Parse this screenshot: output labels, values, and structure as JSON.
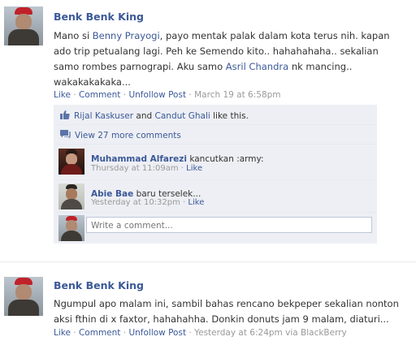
{
  "post1": {
    "author": "Benk Benk King",
    "text_lines": [
      [
        "Mano si ",
        "Benny Prayogi",
        ", payo mentak palak dalam kota terus nih. kapan"
      ],
      [
        "ado trip petualang lagi. Peh ke Semendo kito.. hahahahaha.. sekalian"
      ],
      [
        "samo rombes parnograpi. Aku samo ",
        "Asril Chandra",
        " nk mancing.."
      ],
      [
        "wakakakakaka..."
      ]
    ],
    "actions": {
      "like": "Like",
      "comment": "Comment",
      "unfollow": "Unfollow Post",
      "sep": "·",
      "time": "March 19 at 6:58pm"
    },
    "likes": {
      "person1": "Rijal Kaskuser",
      "and": " and ",
      "person2": "Candut Ghali",
      "suffix": " like this."
    },
    "view_comments": "View 27 more comments",
    "comments": [
      {
        "name": "Muhammad Alfarezi",
        "text": " kancutkan :army:",
        "time": "Thursday at 11:09am",
        "like": "Like"
      },
      {
        "name": "Abie Bae",
        "text": " baru terselek...",
        "time": "Yesterday at 10:32pm",
        "like": "Like"
      }
    ],
    "comment_placeholder": "Write a comment..."
  },
  "post2": {
    "author": "Benk Benk King",
    "text_lines": [
      "Ngumpul apo malam ini, sambil bahas rencano bekpeper sekalian nonton",
      "aksi fthin di x faxtor, hahahahha. Donkin donuts jam 9 malam, diaturi..."
    ],
    "actions": {
      "like": "Like",
      "comment": "Comment",
      "unfollow": "Unfollow Post",
      "sep": "·",
      "time": "Yesterday at 6:24pm via BlackBerry"
    }
  },
  "colors": {
    "link": "#3b5998",
    "ufi_bg": "#edeff4",
    "meta": "#999999"
  }
}
